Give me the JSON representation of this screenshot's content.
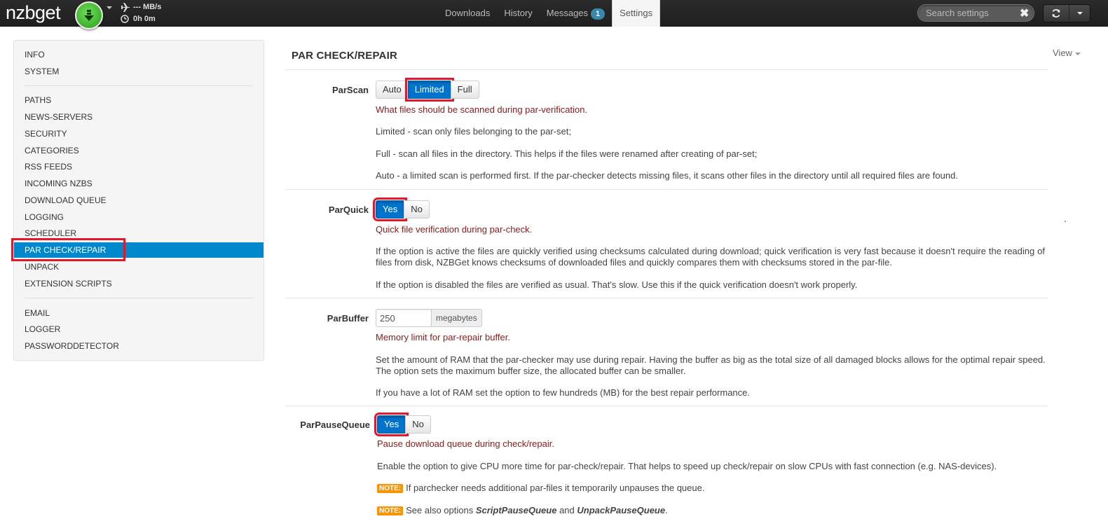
{
  "navbar": {
    "logo": "nzbget",
    "speed": "--- MB/s",
    "time": "0h 0m",
    "tabs": [
      "Downloads",
      "History",
      "Messages",
      "Settings"
    ],
    "messages_badge": "1",
    "search_placeholder": "Search settings"
  },
  "sidebar": {
    "items": [
      "INFO",
      "SYSTEM",
      "PATHS",
      "NEWS-SERVERS",
      "SECURITY",
      "CATEGORIES",
      "RSS FEEDS",
      "INCOMING NZBS",
      "DOWNLOAD QUEUE",
      "LOGGING",
      "SCHEDULER",
      "PAR CHECK/REPAIR",
      "UNPACK",
      "EXTENSION SCRIPTS",
      "EMAIL",
      "LOGGER",
      "PASSWORDDETECTOR"
    ],
    "active": "PAR CHECK/REPAIR"
  },
  "main": {
    "title": "PAR CHECK/REPAIR",
    "view_label": "View",
    "parscan": {
      "label": "ParScan",
      "options": [
        "Auto",
        "Limited",
        "Full"
      ],
      "selected": "Limited",
      "short": "What files should be scanned during par-verification.",
      "p1": "Limited - scan only files belonging to the par-set;",
      "p2": "Full - scan all files in the directory. This helps if the files were renamed after creating of par-set;",
      "p3": "Auto - a limited scan is performed first. If the par-checker detects missing files, it scans other files in the directory until all required files are found."
    },
    "parquick": {
      "label": "ParQuick",
      "options": [
        "Yes",
        "No"
      ],
      "selected": "Yes",
      "short": "Quick file verification during par-check.",
      "p1": "If the option is active the files are quickly verified using checksums calculated during download; quick verification is very fast because it doesn't require the reading of files from disk, NZBGet knows checksums of downloaded files and quickly compares them with checksums stored in the par-file.",
      "p2": "If the option is disabled the files are verified as usual. That's slow. Use this if the quick verification doesn't work properly."
    },
    "parbuffer": {
      "label": "ParBuffer",
      "value": "250",
      "unit": "megabytes",
      "short": "Memory limit for par-repair buffer.",
      "p1": "Set the amount of RAM that the par-checker may use during repair. Having the buffer as big as the total size of all damaged blocks allows for the optimal repair speed. The option sets the maximum buffer size, the allocated buffer can be smaller.",
      "p2": "If you have a lot of RAM set the option to few hundreds (MB) for the best repair performance."
    },
    "parpausequeue": {
      "label": "ParPauseQueue",
      "options": [
        "Yes",
        "No"
      ],
      "selected": "Yes",
      "short": "Pause download queue during check/repair.",
      "p1": "Enable the option to give CPU more time for par-check/repair. That helps to speed up check/repair on slow CPUs with fast connection (e.g. NAS-devices).",
      "note_label": "NOTE:",
      "note1": "If parchecker needs additional par-files it temporarily unpauses the queue.",
      "note2_prefix": "See also options ",
      "note2_opt1": "ScriptPauseQueue",
      "note2_and": " and ",
      "note2_opt2": "UnpackPauseQueue",
      "note2_suffix": "."
    }
  },
  "colors": {
    "accent": "#0088cc",
    "selected_button": "#0074cc",
    "highlight": "#e01a2a",
    "short_desc": "#8b1a1a",
    "note": "#f89406"
  }
}
